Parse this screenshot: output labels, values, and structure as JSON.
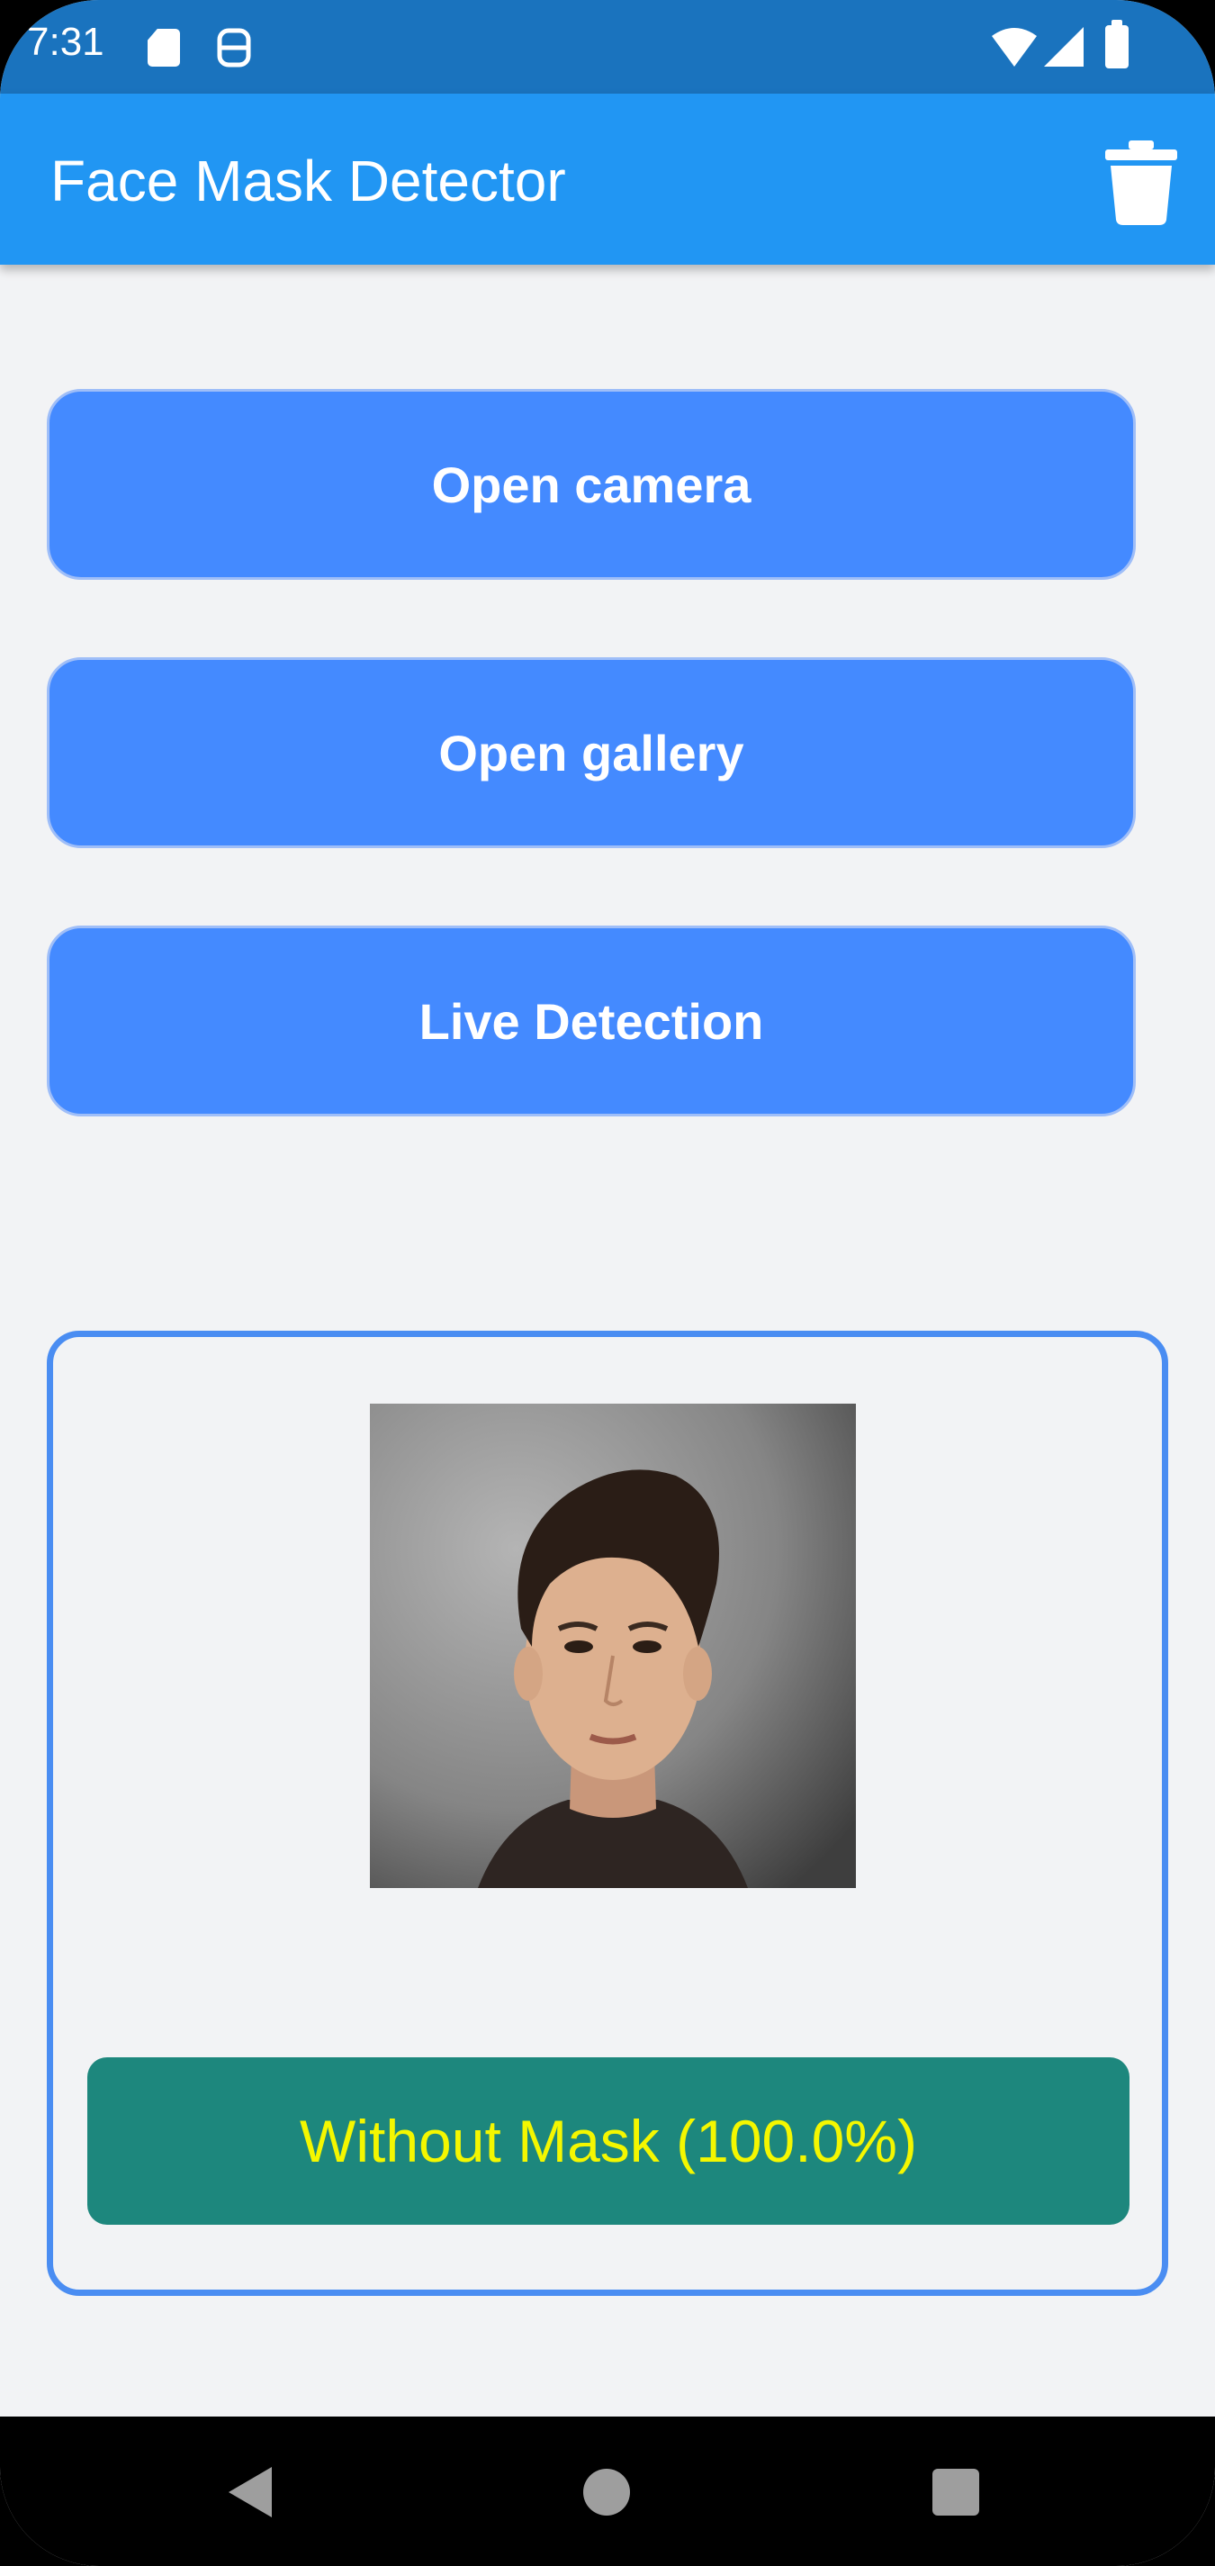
{
  "status_bar": {
    "time": "7:31",
    "icons": [
      "sd-card-icon",
      "app-notification-icon",
      "wifi-icon",
      "signal-icon",
      "battery-icon"
    ]
  },
  "app_bar": {
    "title": "Face Mask Detector",
    "action_icon": "trash-icon"
  },
  "buttons": {
    "open_camera": "Open camera",
    "open_gallery": "Open gallery",
    "live_detection": "Live Detection"
  },
  "result": {
    "image_icon": "face-photo",
    "label": "Without Mask (100.0%)"
  },
  "nav_bar": {
    "icons": [
      "back-icon",
      "home-icon",
      "recents-icon"
    ]
  },
  "colors": {
    "status_bar": "#1a73be",
    "app_bar": "#2196f3",
    "button": "#448aff",
    "card_border": "#4a8df2",
    "result_bg": "#1d877d",
    "result_text": "#f4f700",
    "background": "#f2f3f5"
  }
}
